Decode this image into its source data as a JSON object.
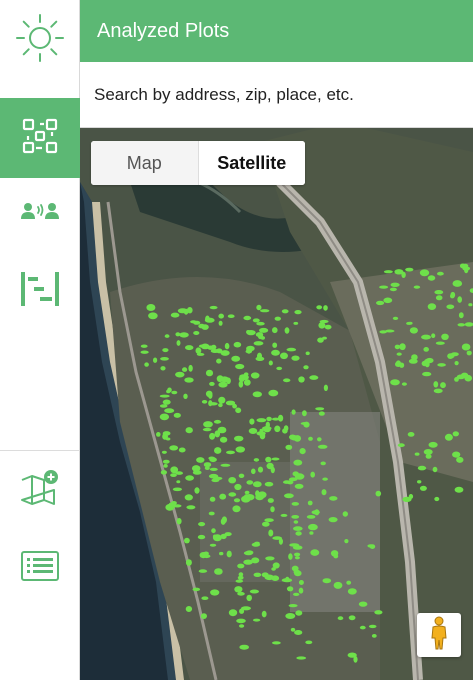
{
  "header": {
    "title": "Analyzed Plots"
  },
  "search": {
    "placeholder": "Search by address, zip, place, etc."
  },
  "map_type": {
    "options": [
      "Map",
      "Satellite"
    ],
    "selected": "Satellite"
  },
  "sidebar": {
    "items": [
      {
        "icon": "sun-icon",
        "active": false
      },
      {
        "icon": "plots-grid-icon",
        "active": true
      },
      {
        "icon": "team-icon",
        "active": false
      },
      {
        "icon": "bars-chart-icon",
        "active": false
      },
      {
        "icon": "map-add-icon",
        "active": false
      },
      {
        "icon": "list-icon",
        "active": false
      }
    ]
  },
  "colors": {
    "accent": "#5cb874",
    "plot_highlight": "#6ee04a",
    "ocean": "#1e2e3a"
  }
}
